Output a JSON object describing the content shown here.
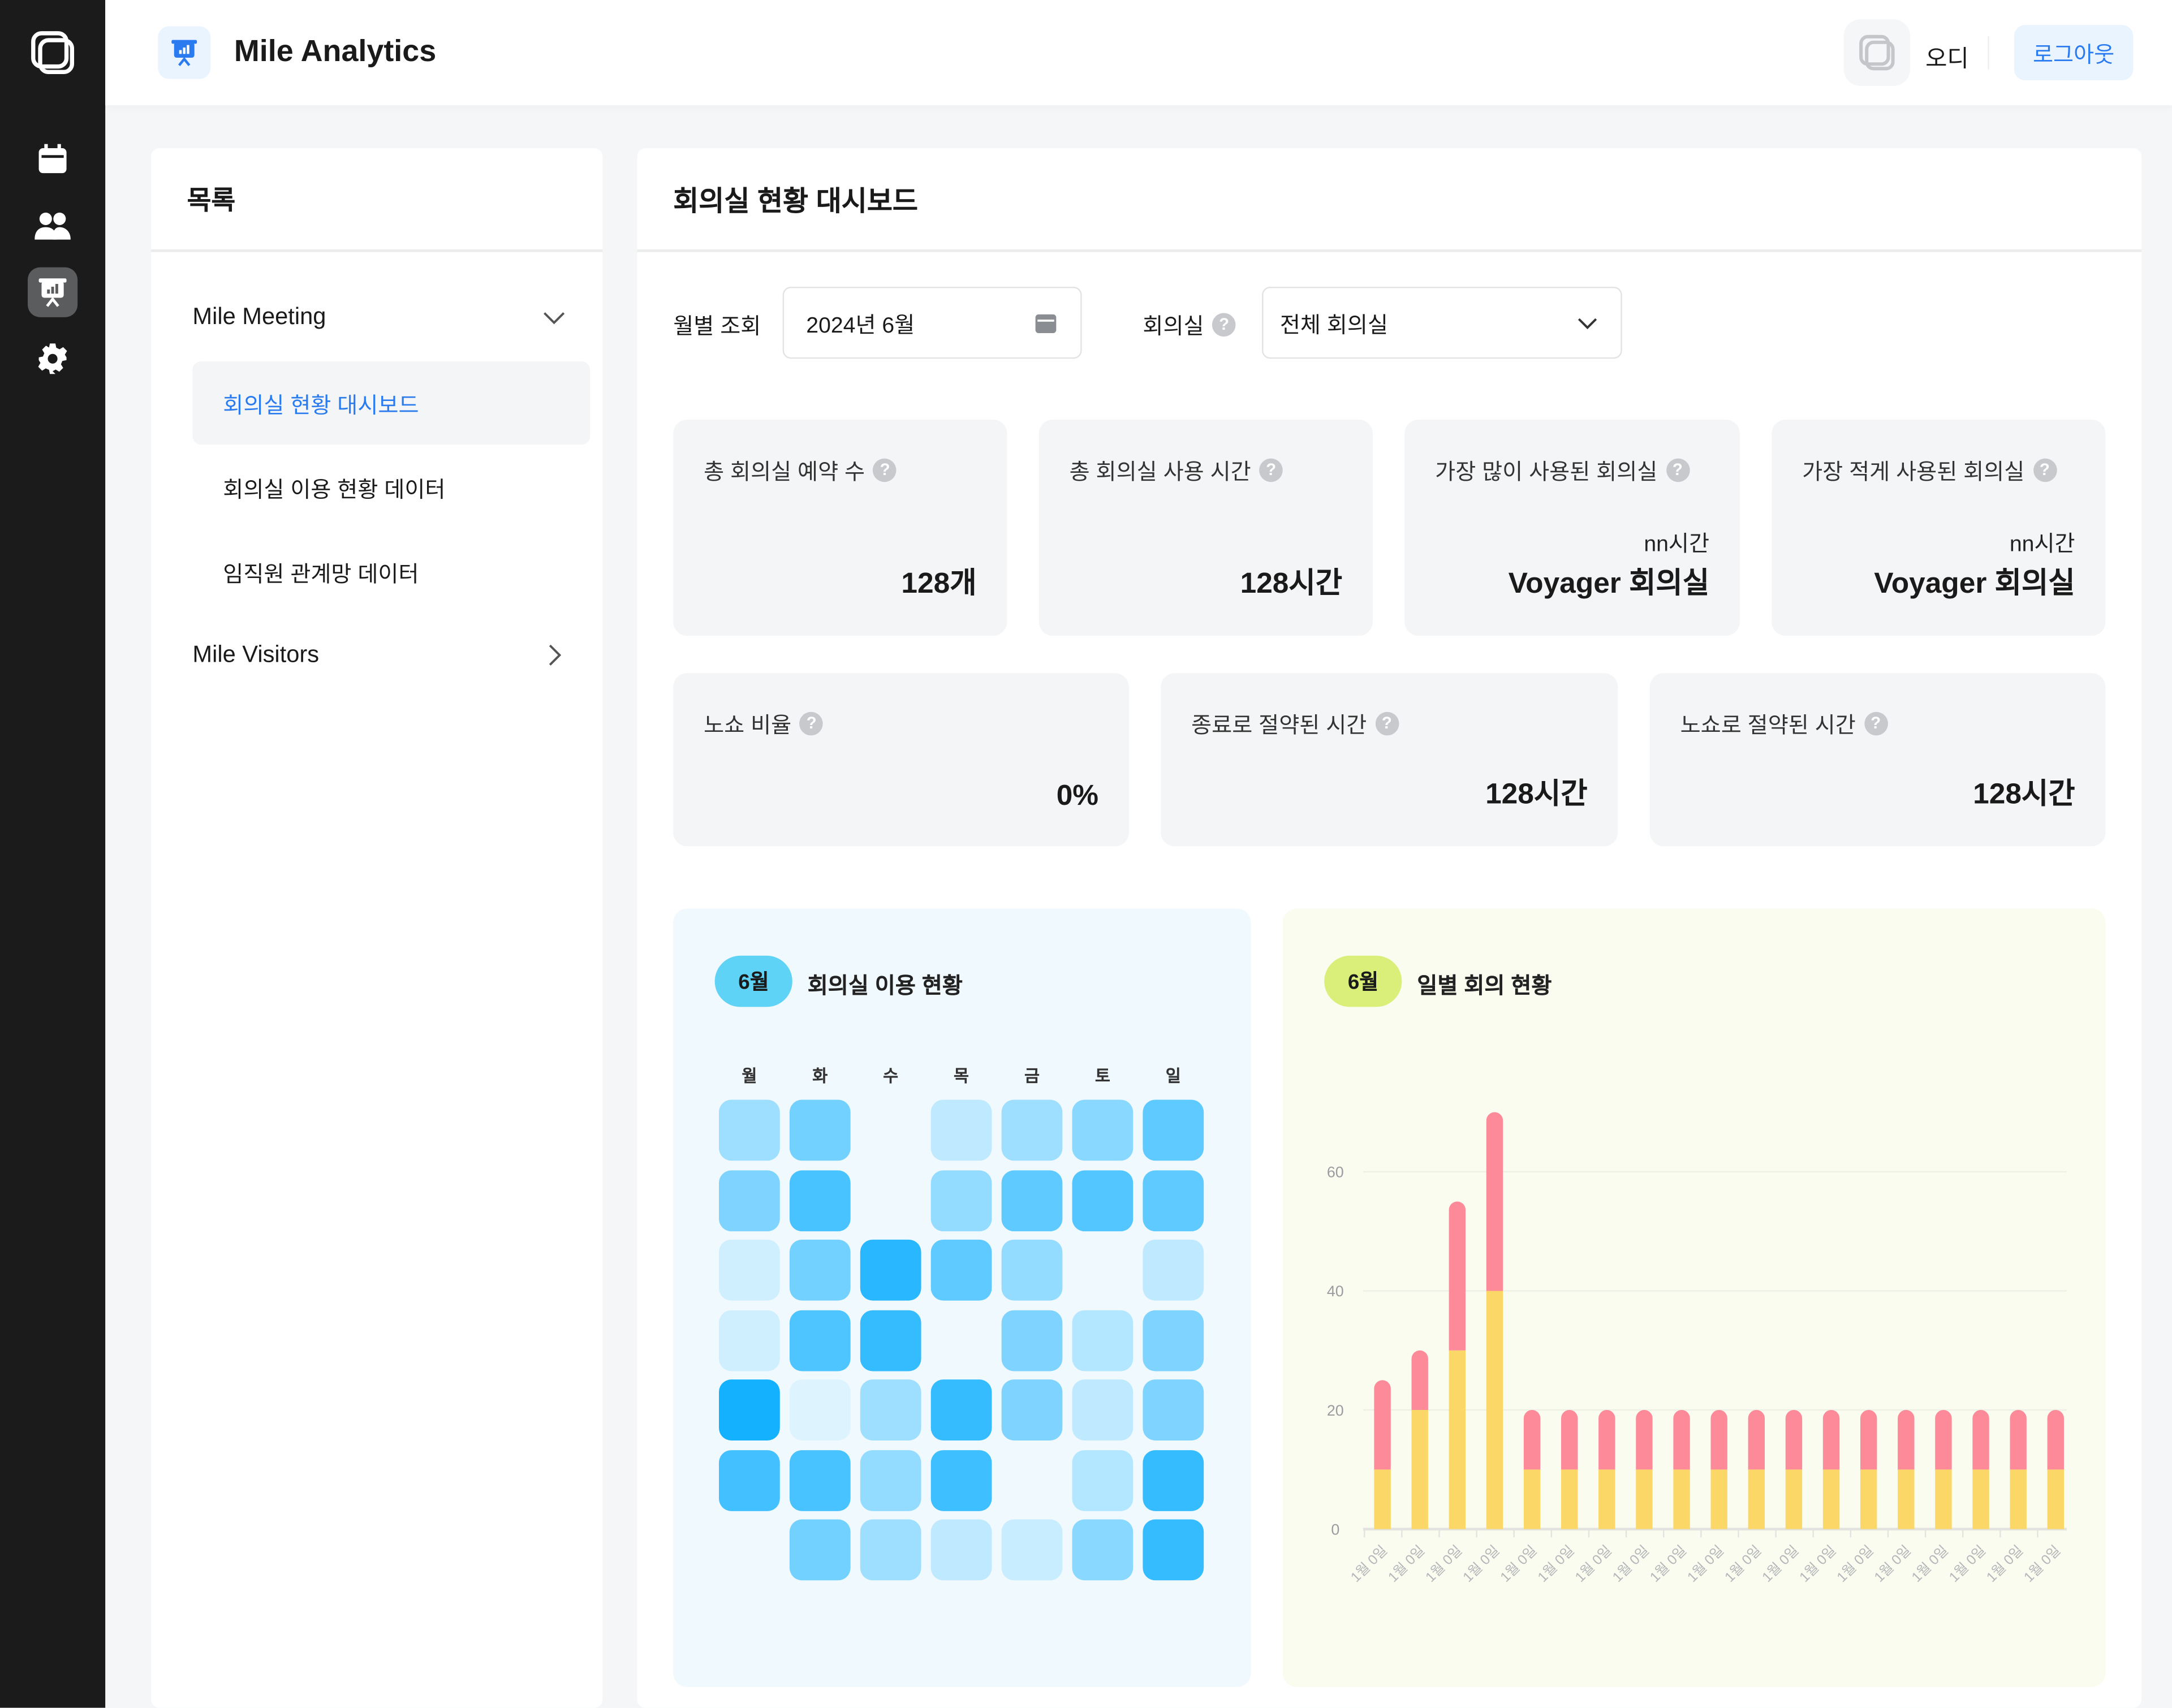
{
  "app": {
    "title": "Mile Analytics",
    "user": "오디",
    "logout": "로그아웃"
  },
  "rail": {
    "icons": [
      "logo-icon",
      "calendar-icon",
      "users-icon",
      "presentation-chart-icon",
      "gear-icon"
    ],
    "active": "presentation-chart-icon"
  },
  "sidebar": {
    "title": "목록",
    "groups": [
      {
        "label": "Mile Meeting",
        "expanded": true,
        "items": [
          {
            "label": "회의실 현황 대시보드",
            "active": true
          },
          {
            "label": "회의실 이용 현황 데이터"
          },
          {
            "label": "임직원 관계망 데이터"
          }
        ]
      },
      {
        "label": "Mile Visitors",
        "expanded": false
      }
    ]
  },
  "main": {
    "title": "회의실 현황 대시보드",
    "filters": {
      "month_label": "월별 조회",
      "month_value": "2024년 6월",
      "room_label": "회의실",
      "room_value": "전체 회의실"
    },
    "stats": [
      {
        "label": "총 회의실 예약 수",
        "value": "128개"
      },
      {
        "label": "총 회의실 사용 시간",
        "value": "128시간"
      },
      {
        "label": "가장 많이 사용된 회의실",
        "sub": "nn시간",
        "value": "Voyager 회의실"
      },
      {
        "label": "가장 적게 사용된 회의실",
        "sub": "nn시간",
        "value": "Voyager 회의실"
      },
      {
        "label": "노쇼 비율",
        "value": "0%"
      },
      {
        "label": "종료로 절약된 시간",
        "value": "128시간"
      },
      {
        "label": "노쇼로 절약된 시간",
        "value": "128시간"
      }
    ]
  },
  "colors": {
    "accent": "#2a7bf0",
    "heat_low": "#e8f7ff",
    "heat_high": "#14b1ff",
    "bar_bottom": "#fad766",
    "bar_top": "#fc8a99",
    "heat_bg": "#f0f9fd",
    "chart_bg": "#fafcef",
    "pill_blue": "#5fd3f5",
    "pill_green": "#d9ef7a"
  },
  "chart_data": [
    {
      "type": "heatmap",
      "badge": "6월",
      "title": "회의실 이용 현황",
      "columns": [
        "월",
        "화",
        "수",
        "목",
        "금",
        "토",
        "일"
      ],
      "values": [
        [
          0.35,
          0.55,
          null,
          0.2,
          0.35,
          0.45,
          0.65
        ],
        [
          0.5,
          0.75,
          null,
          0.4,
          0.65,
          0.7,
          0.65
        ],
        [
          0.12,
          0.55,
          0.9,
          0.65,
          0.4,
          null,
          0.2
        ],
        [
          0.12,
          0.72,
          0.85,
          null,
          0.5,
          0.25,
          0.5
        ],
        [
          1,
          0.05,
          0.35,
          0.85,
          0.5,
          0.2,
          0.5
        ],
        [
          0.78,
          0.75,
          0.4,
          0.8,
          null,
          0.25,
          0.85
        ],
        [
          null,
          0.55,
          0.35,
          0.2,
          0.15,
          0.45,
          0.85
        ]
      ]
    },
    {
      "type": "bar",
      "stacked": true,
      "badge": "6월",
      "title": "일별 회의 현황",
      "categories": [
        "1월 0일",
        "1월 0일",
        "1월 0일",
        "1월 0일",
        "1월 0일",
        "1월 0일",
        "1월 0일",
        "1월 0일",
        "1월 0일",
        "1월 0일",
        "1월 0일",
        "1월 0일",
        "1월 0일",
        "1월 0일",
        "1월 0일",
        "1월 0일",
        "1월 0일",
        "1월 0일",
        "1월 0일"
      ],
      "series": [
        {
          "color": "#fad766",
          "values": [
            10,
            20,
            30,
            40,
            10,
            10,
            10,
            10,
            10,
            10,
            10,
            10,
            10,
            10,
            10,
            10,
            10,
            10,
            10
          ]
        },
        {
          "color": "#fc8a99",
          "values": [
            15,
            10,
            25,
            30,
            10,
            10,
            10,
            10,
            10,
            10,
            10,
            10,
            10,
            10,
            10,
            10,
            10,
            10,
            10
          ]
        }
      ],
      "yticks": [
        0,
        20,
        40,
        60
      ],
      "ylim": [
        0,
        70
      ],
      "grid": true
    }
  ]
}
